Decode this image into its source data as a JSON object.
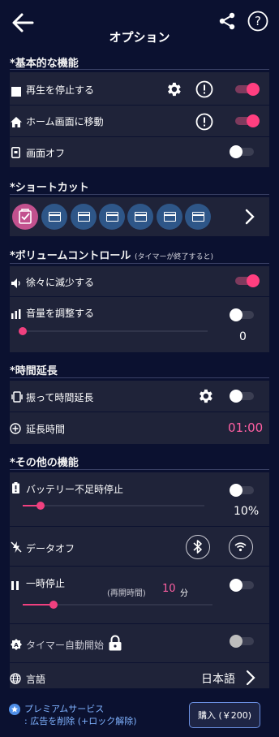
{
  "header": {
    "title": "オプション"
  },
  "sections": {
    "basic": "*基本的な機能",
    "shortcut": "*ショートカット",
    "volume": "*ボリュームコントロール",
    "volume_note": "(タイマーが終了すると)",
    "extend": "*時間延長",
    "other": "*その他の機能"
  },
  "basic": {
    "stop_playback": {
      "label": "再生を停止する",
      "on": true
    },
    "go_home": {
      "label": "ホーム画面に移動",
      "on": true
    },
    "screen_off": {
      "label": "画面オフ",
      "on": false
    }
  },
  "shortcuts": {
    "slot_count": 7,
    "active_index": 0
  },
  "volume": {
    "fade": {
      "label": "徐々に減少する",
      "on": true
    },
    "adjust": {
      "label": "音量を調整する",
      "on": false,
      "value": "0",
      "level": 0
    }
  },
  "extend": {
    "shake": {
      "label": "振って時間延長",
      "on": false
    },
    "extension_time": {
      "label": "延長時間",
      "value": "01:00"
    }
  },
  "other": {
    "battery": {
      "label": "バッテリー不足時停止",
      "on": false,
      "value": "10%",
      "level": 0.1
    },
    "data_off": {
      "label": "データオフ"
    },
    "pause": {
      "label": "一時停止",
      "resume_label": "(再開時間)",
      "resume_value": "10",
      "resume_unit": "分",
      "on": false,
      "level": 0.17
    },
    "auto_start": {
      "label": "タイマー自動開始",
      "on": false
    },
    "language": {
      "label": "言語",
      "value": "日本語"
    }
  },
  "footer": {
    "premium_line1": "プレミアムサービス",
    "premium_line2": ": 広告を削除 (+ロック解除)",
    "buy_label": "購入 (￥200)"
  },
  "colors": {
    "accent": "#ff3f80",
    "background": "#0b1130",
    "card": "#1f2339"
  }
}
